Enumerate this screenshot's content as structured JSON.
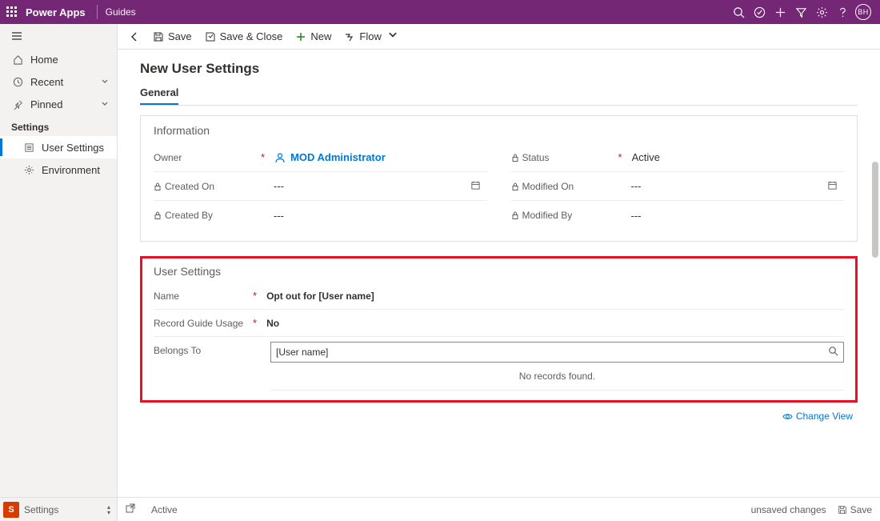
{
  "header": {
    "brand": "Power Apps",
    "area": "Guides",
    "avatar": "BH"
  },
  "sidebar": {
    "home": "Home",
    "recent": "Recent",
    "pinned": "Pinned",
    "section": "Settings",
    "items": [
      "User Settings",
      "Environment"
    ]
  },
  "commands": {
    "save": "Save",
    "save_close": "Save & Close",
    "new": "New",
    "flow": "Flow"
  },
  "page": {
    "title": "New User Settings",
    "tab": "General"
  },
  "info": {
    "title": "Information",
    "owner_label": "Owner",
    "owner_value": "MOD Administrator",
    "status_label": "Status",
    "status_value": "Active",
    "created_on_label": "Created On",
    "created_on_value": "---",
    "modified_on_label": "Modified On",
    "modified_on_value": "---",
    "created_by_label": "Created By",
    "created_by_value": "---",
    "modified_by_label": "Modified By",
    "modified_by_value": "---"
  },
  "user_settings": {
    "title": "User Settings",
    "name_label": "Name",
    "name_value": "Opt out for [User name]",
    "record_label": "Record Guide Usage",
    "record_value": "No",
    "belongs_label": "Belongs To",
    "belongs_value": "[User name]",
    "no_records": "No records found.",
    "change_view": "Change View"
  },
  "footer": {
    "area": "Settings",
    "status": "Active",
    "unsaved": "unsaved changes",
    "save": "Save"
  }
}
